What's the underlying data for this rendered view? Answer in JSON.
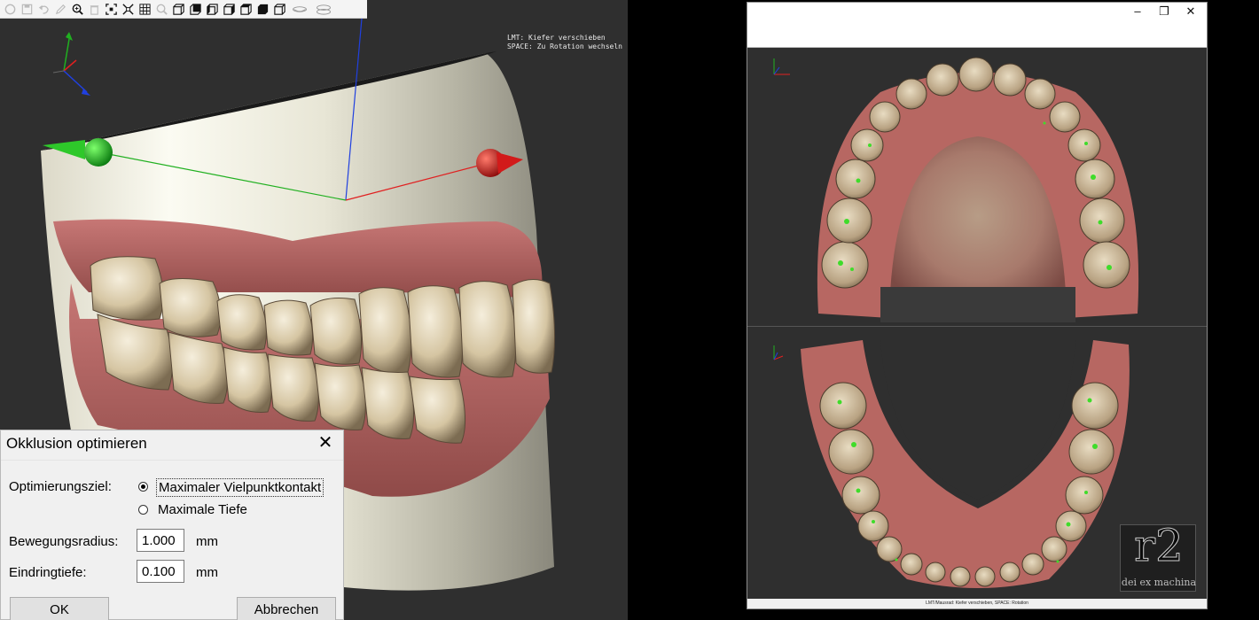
{
  "left_view": {
    "toolbar_icons": [
      "undo-icon",
      "save-icon",
      "undo-arrow-icon",
      "pencil-icon",
      "zoom-icon",
      "trash-icon",
      "fit-icon",
      "explode-icon",
      "grid-icon",
      "search-icon",
      "view-front-icon",
      "view-back-icon",
      "view-left-icon",
      "view-right-icon",
      "view-top-icon",
      "view-bottom-icon",
      "view-iso-icon",
      "lower-jaw-icon",
      "upper-jaw-icon",
      "both-jaws-icon"
    ],
    "hint_text": "LMT: Kiefer verschieben\nSPACE: Zu Rotation wechseln"
  },
  "dialog": {
    "title": "Okklusion optimieren",
    "target_label": "Optimierungsziel:",
    "option_multipoint": "Maximaler Vielpunktkontakt",
    "option_depth": "Maximale Tiefe",
    "selected_option": "Maximaler Vielpunktkontakt",
    "radius_label": "Bewegungsradius:",
    "radius_value": "1.000",
    "radius_unit": "mm",
    "depth_label": "Eindringtiefe:",
    "depth_value": "0.100",
    "depth_unit": "mm",
    "ok_label": "OK",
    "cancel_label": "Abbrechen"
  },
  "right_window": {
    "controls": {
      "minimize": "–",
      "maximize": "❐",
      "close": "✕"
    },
    "status_text": "LMT/Mausrad: Kiefer verschieben, SPACE: Rotation",
    "logo_main": "r2",
    "logo_sub": "dei ex machina"
  },
  "colors": {
    "gum": "#b5605e",
    "tooth": "#d7c9a9",
    "contact_marks": "#3fdc2a",
    "axis_x": "#e02020",
    "axis_y": "#20b020",
    "axis_z": "#2040e0",
    "viewport_bg": "#2f2f2f"
  }
}
